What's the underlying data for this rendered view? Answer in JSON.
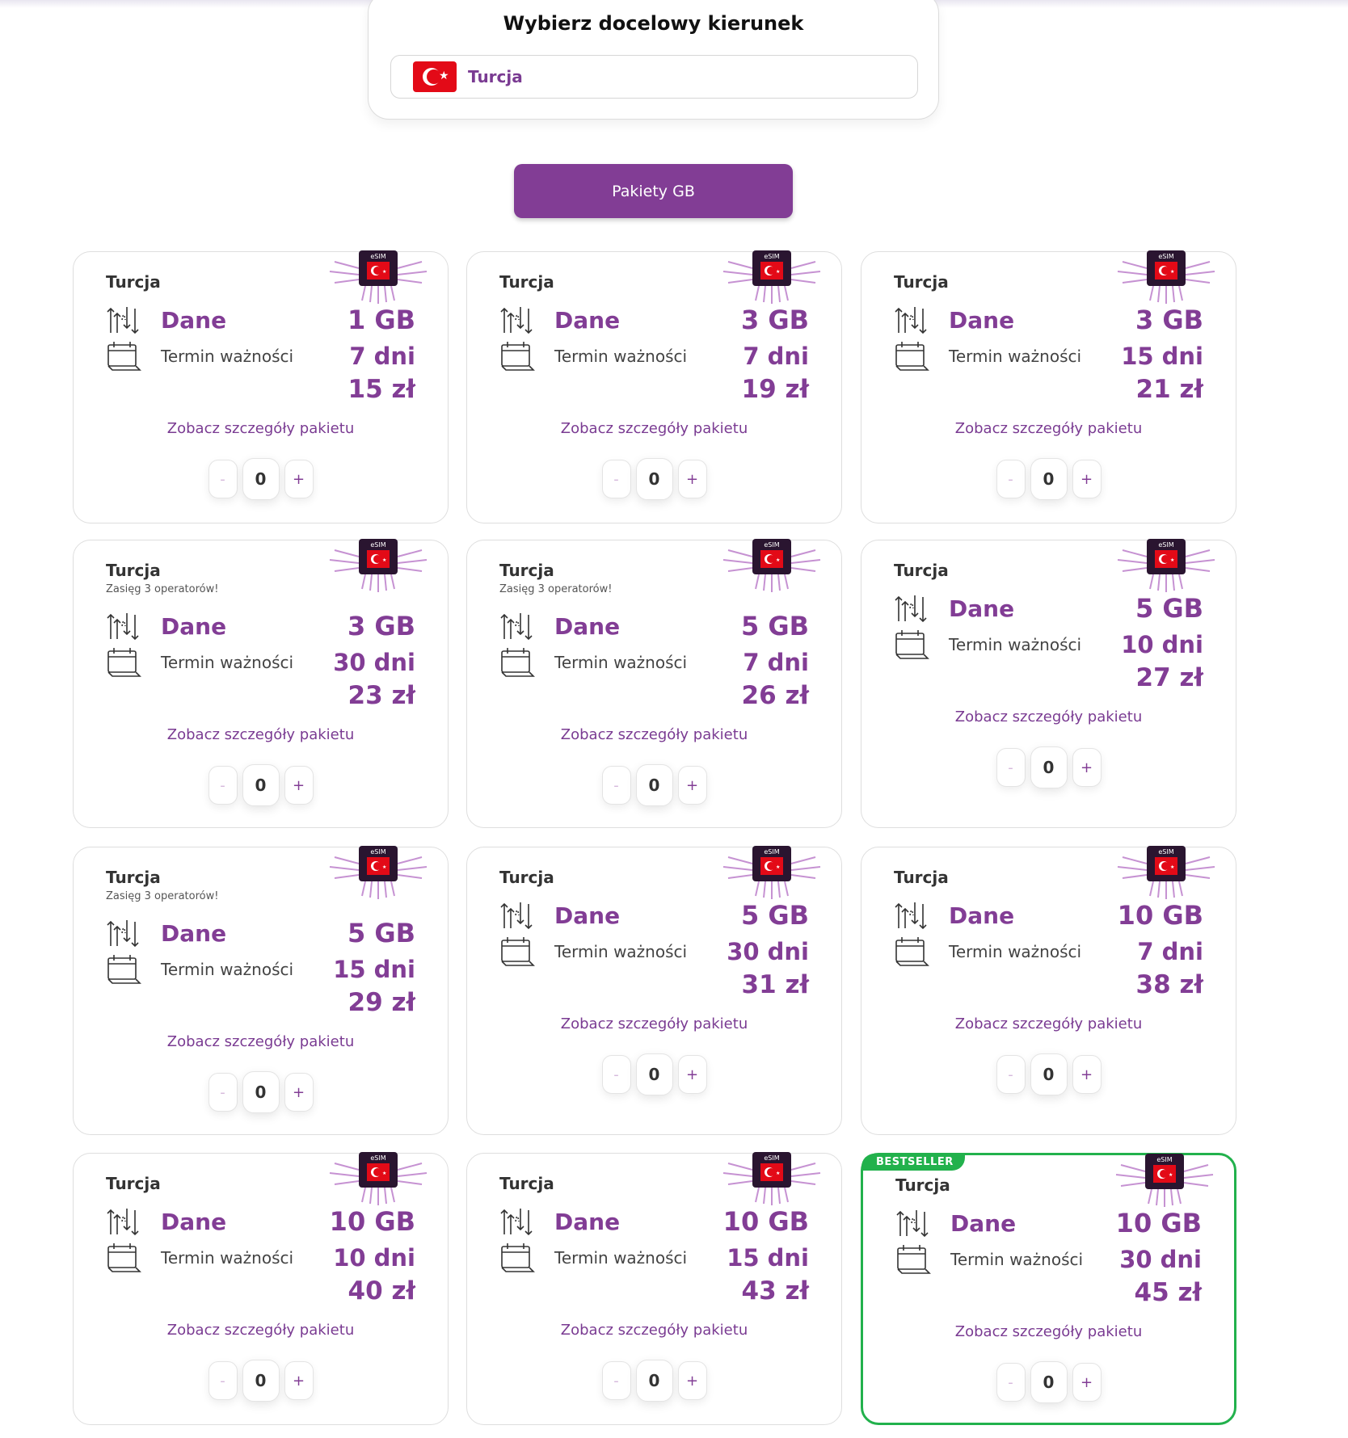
{
  "destination": {
    "title": "Wybierz docelowy kierunek",
    "selected": "Turcja",
    "flag_icon": "turkey-flag"
  },
  "tabs": [
    {
      "label": "Pakiety GB",
      "active": true
    }
  ],
  "colors": {
    "accent": "#823d95",
    "bestseller": "#22b14c"
  },
  "packages": [
    {
      "country": "Turcja",
      "note": "",
      "data_label": "Dane",
      "data": "1 GB",
      "term_label": "Termin ważności",
      "term": "7 dni",
      "price": "15 zł",
      "details_link": "Zobacz szczegóły pakietu",
      "quantity": "0",
      "bestseller": false
    },
    {
      "country": "Turcja",
      "note": "",
      "data_label": "Dane",
      "data": "3 GB",
      "term_label": "Termin ważności",
      "term": "7 dni",
      "price": "19 zł",
      "details_link": "Zobacz szczegóły pakietu",
      "quantity": "0",
      "bestseller": false
    },
    {
      "country": "Turcja",
      "note": "",
      "data_label": "Dane",
      "data": "3 GB",
      "term_label": "Termin ważności",
      "term": "15 dni",
      "price": "21 zł",
      "details_link": "Zobacz szczegóły pakietu",
      "quantity": "0",
      "bestseller": false
    },
    {
      "country": "Turcja",
      "note": "Zasięg 3 operatorów!",
      "data_label": "Dane",
      "data": "3 GB",
      "term_label": "Termin ważności",
      "term": "30 dni",
      "price": "23 zł",
      "details_link": "Zobacz szczegóły pakietu",
      "quantity": "0",
      "bestseller": false
    },
    {
      "country": "Turcja",
      "note": "Zasięg 3 operatorów!",
      "data_label": "Dane",
      "data": "5 GB",
      "term_label": "Termin ważności",
      "term": "7 dni",
      "price": "26 zł",
      "details_link": "Zobacz szczegóły pakietu",
      "quantity": "0",
      "bestseller": false
    },
    {
      "country": "Turcja",
      "note": "",
      "data_label": "Dane",
      "data": "5 GB",
      "term_label": "Termin ważności",
      "term": "10 dni",
      "price": "27 zł",
      "details_link": "Zobacz szczegóły pakietu",
      "quantity": "0",
      "bestseller": false
    },
    {
      "country": "Turcja",
      "note": "Zasięg 3 operatorów!",
      "data_label": "Dane",
      "data": "5 GB",
      "term_label": "Termin ważności",
      "term": "15 dni",
      "price": "29 zł",
      "details_link": "Zobacz szczegóły pakietu",
      "quantity": "0",
      "bestseller": false
    },
    {
      "country": "Turcja",
      "note": "",
      "data_label": "Dane",
      "data": "5 GB",
      "term_label": "Termin ważności",
      "term": "30 dni",
      "price": "31 zł",
      "details_link": "Zobacz szczegóły pakietu",
      "quantity": "0",
      "bestseller": false
    },
    {
      "country": "Turcja",
      "note": "",
      "data_label": "Dane",
      "data": "10 GB",
      "term_label": "Termin ważności",
      "term": "7 dni",
      "price": "38 zł",
      "details_link": "Zobacz szczegóły pakietu",
      "quantity": "0",
      "bestseller": false
    },
    {
      "country": "Turcja",
      "note": "",
      "data_label": "Dane",
      "data": "10 GB",
      "term_label": "Termin ważności",
      "term": "10 dni",
      "price": "40 zł",
      "details_link": "Zobacz szczegóły pakietu",
      "quantity": "0",
      "bestseller": false
    },
    {
      "country": "Turcja",
      "note": "",
      "data_label": "Dane",
      "data": "10 GB",
      "term_label": "Termin ważności",
      "term": "15 dni",
      "price": "43 zł",
      "details_link": "Zobacz szczegóły pakietu",
      "quantity": "0",
      "bestseller": false
    },
    {
      "country": "Turcja",
      "note": "",
      "data_label": "Dane",
      "data": "10 GB",
      "term_label": "Termin ważności",
      "term": "30 dni",
      "price": "45 zł",
      "details_link": "Zobacz szczegóły pakietu",
      "quantity": "0",
      "bestseller": true,
      "badge": "BESTSELLER"
    }
  ],
  "esim_label": "eSIM",
  "qty_minus": "-",
  "qty_plus": "+"
}
